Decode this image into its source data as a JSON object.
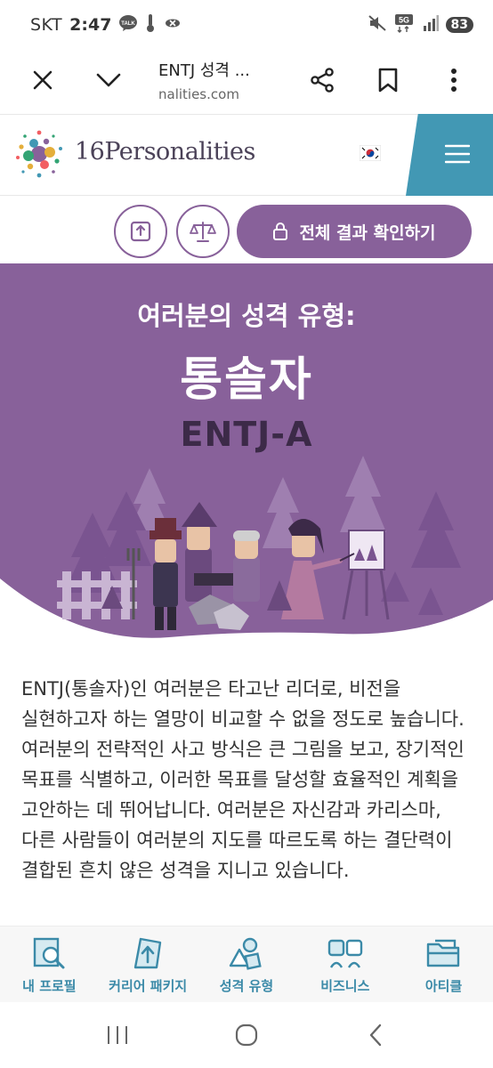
{
  "status": {
    "carrier": "SKT",
    "time": "2:47",
    "network": "5G",
    "battery": "83"
  },
  "browser": {
    "title": "ENTJ 성격 ...",
    "url": "nalities.com"
  },
  "site": {
    "brand": "16Personalities",
    "logo_colors": [
      "#33a474",
      "#e4ae3a",
      "#88619a",
      "#4298b4",
      "#f25e62"
    ]
  },
  "actions": {
    "cta_label": "전체 결과 확인하기"
  },
  "hero": {
    "subtitle": "여러분의 성격 유형:",
    "title": "통솔자",
    "code": "ENTJ-A",
    "bg_color": "#88619a"
  },
  "description": "ENTJ(통솔자)인 여러분은 타고난 리더로, 비전을 실현하고자 하는 열망이 비교할 수 없을 정도로 높습니다. 여러분의 전략적인 사고 방식은 큰 그림을 보고, 장기적인 목표를 식별하고, 이러한 목표를 달성할 효율적인 계획을 고안하는 데 뛰어납니다. 여러분은 자신감과 카리스마, 다른 사람들이 여러분의 지도를 따르도록 하는 결단력이 결합된 흔치 않은 성격을 지니고 있습니다.",
  "tabs": [
    {
      "label": "내 프로필",
      "icon": "profile-search-icon"
    },
    {
      "label": "커리어 패키지",
      "icon": "career-arrow-icon"
    },
    {
      "label": "성격 유형",
      "icon": "shapes-icon"
    },
    {
      "label": "비즈니스",
      "icon": "people-icon"
    },
    {
      "label": "아티클",
      "icon": "folder-icon"
    }
  ],
  "colors": {
    "accent_purple": "#88619a",
    "accent_blue": "#4298b4",
    "tab_blue": "#3b8aa8"
  }
}
